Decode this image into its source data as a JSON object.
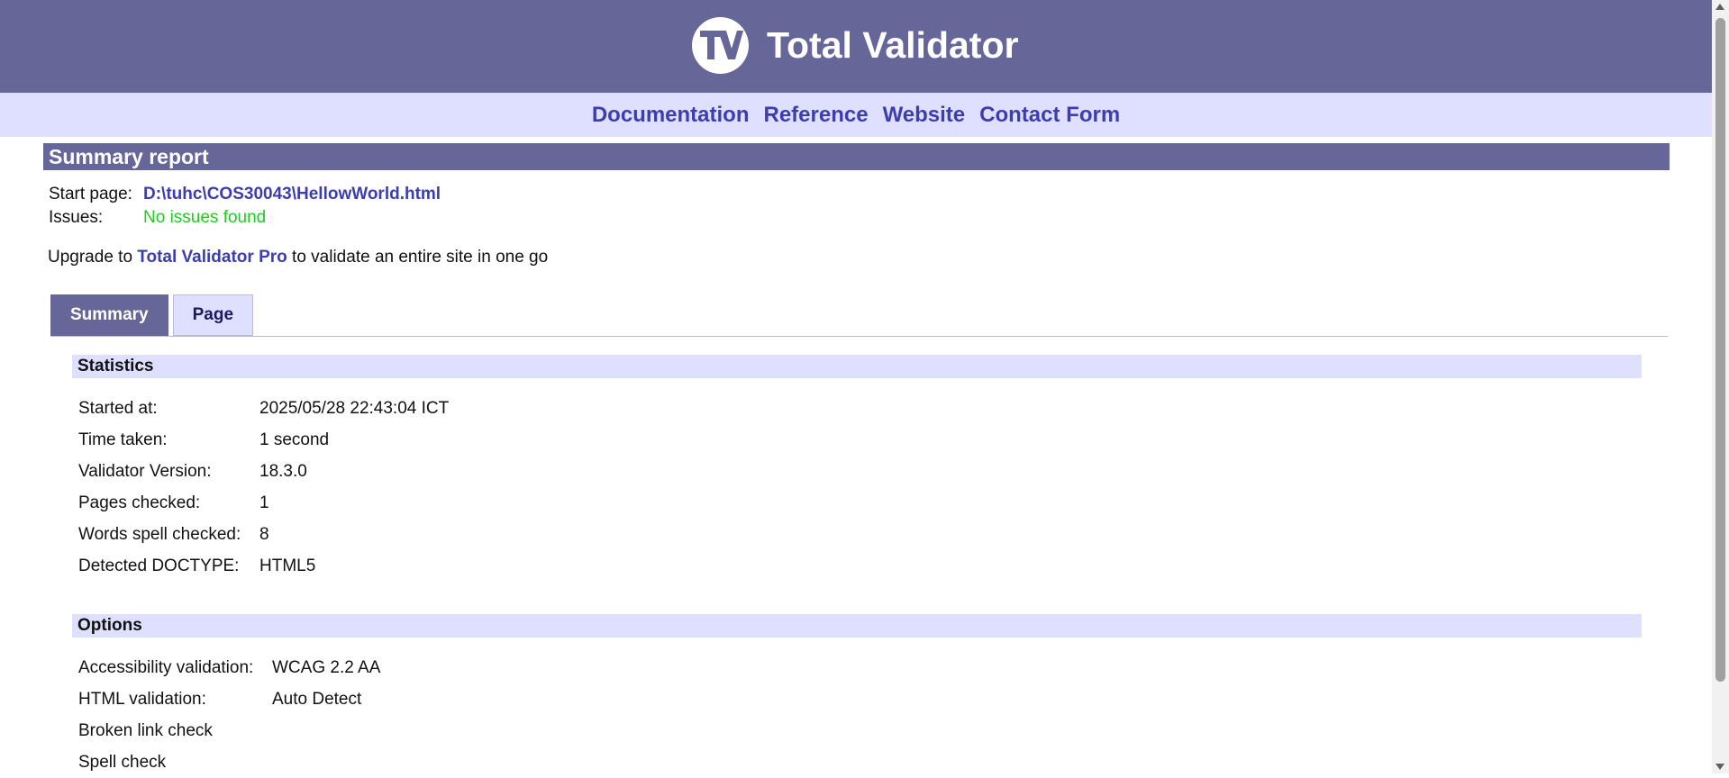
{
  "header": {
    "title": "Total Validator",
    "logo_text": "TV"
  },
  "nav": {
    "items": [
      "Documentation",
      "Reference",
      "Website",
      "Contact Form"
    ]
  },
  "report": {
    "title": "Summary report",
    "start_page_label": "Start page:",
    "start_page_value": "D:\\tuhc\\COS30043\\HellowWorld.html",
    "issues_label": "Issues:",
    "issues_value": "No issues found"
  },
  "upgrade": {
    "prefix": "Upgrade to",
    "link": "Total Validator Pro",
    "suffix": "to validate an entire site in one go"
  },
  "tabs": [
    {
      "label": "Summary",
      "active": true
    },
    {
      "label": "Page",
      "active": false
    }
  ],
  "statistics": {
    "title": "Statistics",
    "rows": [
      {
        "label": "Started at:",
        "value": "2025/05/28 22:43:04 ICT"
      },
      {
        "label": "Time taken:",
        "value": "1 second"
      },
      {
        "label": "Validator Version:",
        "value": "18.3.0"
      },
      {
        "label": "Pages checked:",
        "value": "1"
      },
      {
        "label": "Words spell checked:",
        "value": "8"
      },
      {
        "label": "Detected DOCTYPE:",
        "value": "HTML5"
      }
    ]
  },
  "options": {
    "title": "Options",
    "rows": [
      {
        "label": "Accessibility validation:",
        "value": "WCAG 2.2 AA"
      },
      {
        "label": "HTML validation:",
        "value": "Auto Detect"
      },
      {
        "label": "Broken link check",
        "value": ""
      },
      {
        "label": "Spell check",
        "value": ""
      }
    ]
  },
  "colors": {
    "header_bg": "#666699",
    "nav_bg": "#dfe0ff",
    "link": "#3d3dae",
    "success": "#1fcc1f"
  }
}
